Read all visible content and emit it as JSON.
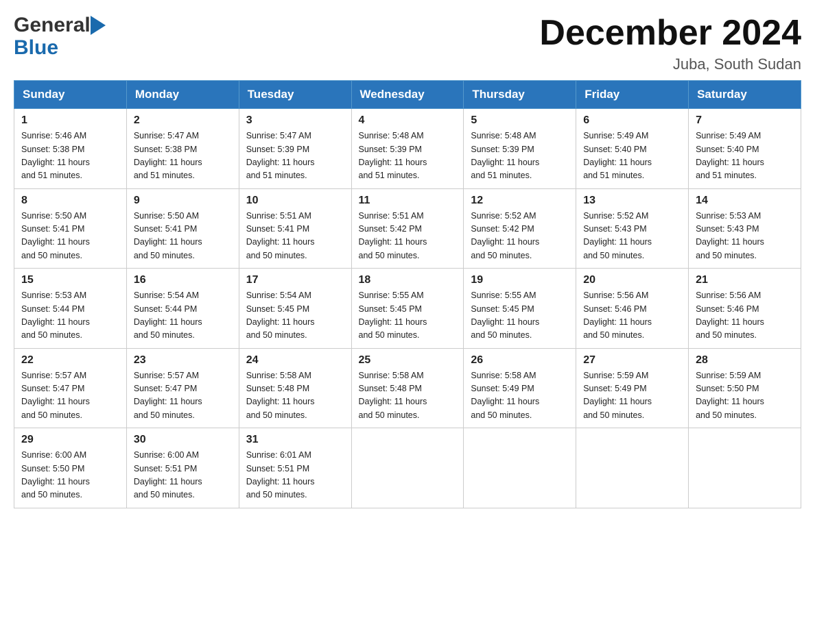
{
  "header": {
    "logo_general": "General",
    "logo_blue": "Blue",
    "month_title": "December 2024",
    "location": "Juba, South Sudan"
  },
  "weekdays": [
    "Sunday",
    "Monday",
    "Tuesday",
    "Wednesday",
    "Thursday",
    "Friday",
    "Saturday"
  ],
  "weeks": [
    [
      {
        "day": "1",
        "sunrise": "5:46 AM",
        "sunset": "5:38 PM",
        "daylight": "11 hours and 51 minutes."
      },
      {
        "day": "2",
        "sunrise": "5:47 AM",
        "sunset": "5:38 PM",
        "daylight": "11 hours and 51 minutes."
      },
      {
        "day": "3",
        "sunrise": "5:47 AM",
        "sunset": "5:39 PM",
        "daylight": "11 hours and 51 minutes."
      },
      {
        "day": "4",
        "sunrise": "5:48 AM",
        "sunset": "5:39 PM",
        "daylight": "11 hours and 51 minutes."
      },
      {
        "day": "5",
        "sunrise": "5:48 AM",
        "sunset": "5:39 PM",
        "daylight": "11 hours and 51 minutes."
      },
      {
        "day": "6",
        "sunrise": "5:49 AM",
        "sunset": "5:40 PM",
        "daylight": "11 hours and 51 minutes."
      },
      {
        "day": "7",
        "sunrise": "5:49 AM",
        "sunset": "5:40 PM",
        "daylight": "11 hours and 51 minutes."
      }
    ],
    [
      {
        "day": "8",
        "sunrise": "5:50 AM",
        "sunset": "5:41 PM",
        "daylight": "11 hours and 50 minutes."
      },
      {
        "day": "9",
        "sunrise": "5:50 AM",
        "sunset": "5:41 PM",
        "daylight": "11 hours and 50 minutes."
      },
      {
        "day": "10",
        "sunrise": "5:51 AM",
        "sunset": "5:41 PM",
        "daylight": "11 hours and 50 minutes."
      },
      {
        "day": "11",
        "sunrise": "5:51 AM",
        "sunset": "5:42 PM",
        "daylight": "11 hours and 50 minutes."
      },
      {
        "day": "12",
        "sunrise": "5:52 AM",
        "sunset": "5:42 PM",
        "daylight": "11 hours and 50 minutes."
      },
      {
        "day": "13",
        "sunrise": "5:52 AM",
        "sunset": "5:43 PM",
        "daylight": "11 hours and 50 minutes."
      },
      {
        "day": "14",
        "sunrise": "5:53 AM",
        "sunset": "5:43 PM",
        "daylight": "11 hours and 50 minutes."
      }
    ],
    [
      {
        "day": "15",
        "sunrise": "5:53 AM",
        "sunset": "5:44 PM",
        "daylight": "11 hours and 50 minutes."
      },
      {
        "day": "16",
        "sunrise": "5:54 AM",
        "sunset": "5:44 PM",
        "daylight": "11 hours and 50 minutes."
      },
      {
        "day": "17",
        "sunrise": "5:54 AM",
        "sunset": "5:45 PM",
        "daylight": "11 hours and 50 minutes."
      },
      {
        "day": "18",
        "sunrise": "5:55 AM",
        "sunset": "5:45 PM",
        "daylight": "11 hours and 50 minutes."
      },
      {
        "day": "19",
        "sunrise": "5:55 AM",
        "sunset": "5:45 PM",
        "daylight": "11 hours and 50 minutes."
      },
      {
        "day": "20",
        "sunrise": "5:56 AM",
        "sunset": "5:46 PM",
        "daylight": "11 hours and 50 minutes."
      },
      {
        "day": "21",
        "sunrise": "5:56 AM",
        "sunset": "5:46 PM",
        "daylight": "11 hours and 50 minutes."
      }
    ],
    [
      {
        "day": "22",
        "sunrise": "5:57 AM",
        "sunset": "5:47 PM",
        "daylight": "11 hours and 50 minutes."
      },
      {
        "day": "23",
        "sunrise": "5:57 AM",
        "sunset": "5:47 PM",
        "daylight": "11 hours and 50 minutes."
      },
      {
        "day": "24",
        "sunrise": "5:58 AM",
        "sunset": "5:48 PM",
        "daylight": "11 hours and 50 minutes."
      },
      {
        "day": "25",
        "sunrise": "5:58 AM",
        "sunset": "5:48 PM",
        "daylight": "11 hours and 50 minutes."
      },
      {
        "day": "26",
        "sunrise": "5:58 AM",
        "sunset": "5:49 PM",
        "daylight": "11 hours and 50 minutes."
      },
      {
        "day": "27",
        "sunrise": "5:59 AM",
        "sunset": "5:49 PM",
        "daylight": "11 hours and 50 minutes."
      },
      {
        "day": "28",
        "sunrise": "5:59 AM",
        "sunset": "5:50 PM",
        "daylight": "11 hours and 50 minutes."
      }
    ],
    [
      {
        "day": "29",
        "sunrise": "6:00 AM",
        "sunset": "5:50 PM",
        "daylight": "11 hours and 50 minutes."
      },
      {
        "day": "30",
        "sunrise": "6:00 AM",
        "sunset": "5:51 PM",
        "daylight": "11 hours and 50 minutes."
      },
      {
        "day": "31",
        "sunrise": "6:01 AM",
        "sunset": "5:51 PM",
        "daylight": "11 hours and 50 minutes."
      },
      null,
      null,
      null,
      null
    ]
  ],
  "labels": {
    "sunrise": "Sunrise:",
    "sunset": "Sunset:",
    "daylight": "Daylight:"
  }
}
